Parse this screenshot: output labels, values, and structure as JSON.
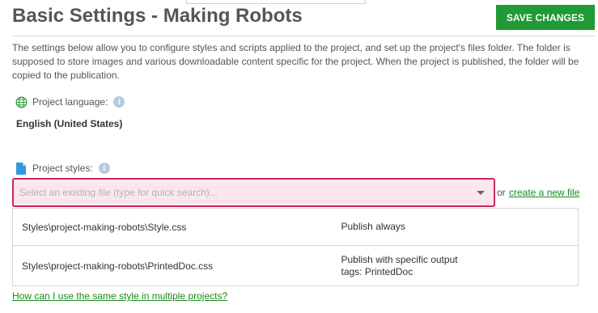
{
  "header": {
    "title": "Basic Settings - Making Robots",
    "save_label": "SAVE CHANGES"
  },
  "description": "The settings below allow you to configure styles and scripts applied to the project, and set up the project's files folder. The folder is supposed to store images and various downloadable content specific for the project. When the project is published, the folder will be copied to the publication.",
  "language": {
    "label": "Project language:",
    "value": "English (United States)",
    "icon": "globe-icon"
  },
  "styles": {
    "label": "Project styles:",
    "icon": "file-icon",
    "select_placeholder": "Select an existing file (type for quick search)...",
    "or_text": "or",
    "create_link": "create a new file",
    "files": [
      {
        "path": "Styles\\project-making-robots\\Style.css",
        "mode": "Publish always"
      },
      {
        "path": "Styles\\project-making-robots\\PrintedDoc.css",
        "mode": "Publish with specific output tags: PrintedDoc"
      }
    ],
    "help_link": "How can I use the same style in multiple projects?"
  },
  "colors": {
    "save_button": "#1f9a35",
    "select_border": "#c9265f",
    "select_background": "#fde6ee",
    "link": "#1a8a1a",
    "info_icon": "#b9c9df"
  }
}
